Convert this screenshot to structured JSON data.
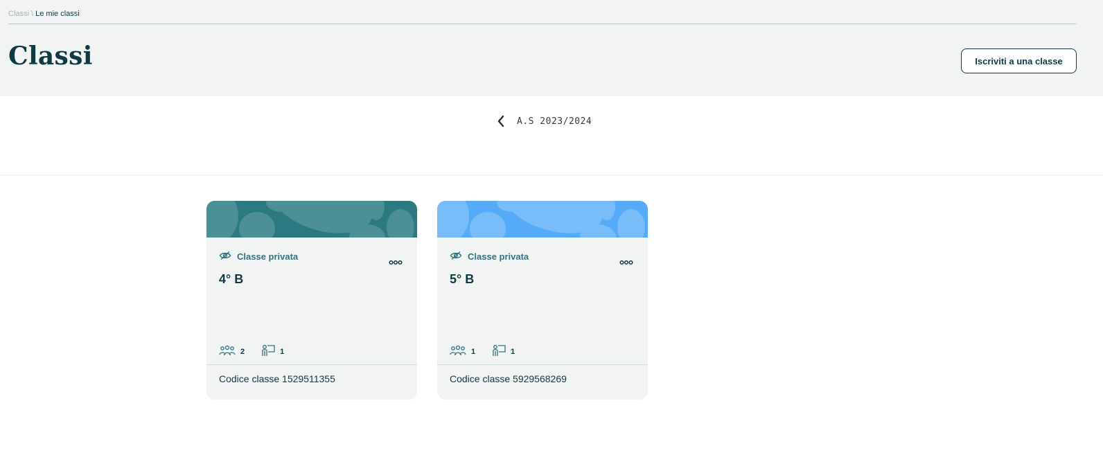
{
  "breadcrumb": {
    "root": "Classi",
    "separator": "\\",
    "current": "Le mie classi"
  },
  "header": {
    "title": "Classi",
    "join_button": "Iscriviti a una classe"
  },
  "year_nav": {
    "prev_icon": "chevron-left-icon",
    "label": "A.S 2023/2024"
  },
  "colors": {
    "primary": "#0f3a44",
    "accent": "#2f7481",
    "banner_teal": "#2b7a82",
    "banner_blue": "#55abf7",
    "surface": "#f1f4f3"
  },
  "classes": [
    {
      "privacy": "Classe privata",
      "name": "4° B",
      "students": "2",
      "teachers": "1",
      "code": "Codice classe 1529511355"
    },
    {
      "privacy": "Classe privata",
      "name": "5° B",
      "students": "1",
      "teachers": "1",
      "code": "Codice classe 5929568269"
    }
  ]
}
